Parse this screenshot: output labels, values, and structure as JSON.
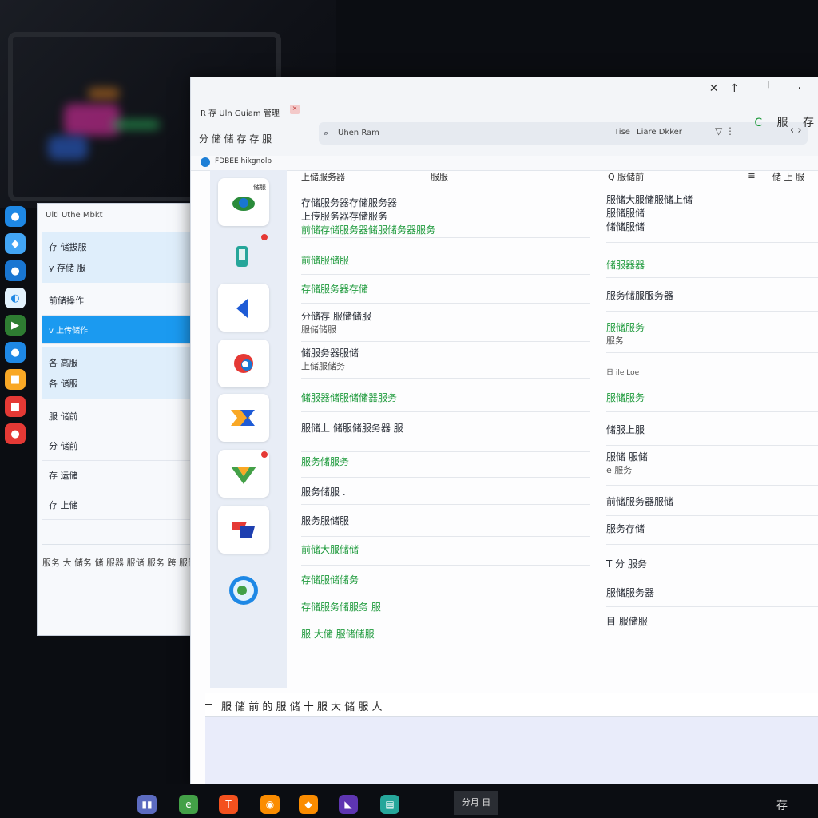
{
  "back_window": {
    "title": "Ulti Uthe Mbkt",
    "group1": [
      "存 储拔服",
      "y 存储 服"
    ],
    "item1": "前储操作",
    "active_item": "v 上传储作",
    "group2": [
      "各 高服",
      "各 储服"
    ],
    "items": [
      "服 储前",
      "分 储前",
      "存 运储",
      "存 上储"
    ],
    "footer": "服务 大 储务 储 服器 服储 服务 跨 服储"
  },
  "main_window": {
    "title": "R 存 Uln Guiam 管理",
    "toolbar_text": "分  储 储 存 存 服",
    "address": {
      "text": "Uhen Ram",
      "tag": "Tise",
      "user": "Liare Dkker",
      "nav": "‹ ›"
    },
    "right_tools": [
      "C",
      "服",
      "存"
    ],
    "subbar_text": "FDBEE hikgnolb"
  },
  "rail": {
    "tile1_badge": "储服"
  },
  "list": {
    "header_left": "上储服务器",
    "header_right": "服服",
    "rows": [
      {
        "line1": "存储服务器存储服务器",
        "line2": "上传服务器存储服务",
        "line3": "前储存储服务器储服储务器服务",
        "green": true
      },
      {
        "line1": "前储服储服",
        "green": true
      },
      {
        "line1": "存储服务器存储",
        "green": true
      },
      {
        "line1": "分储存 服储储服",
        "line2": "服储储服"
      },
      {
        "line1": "储服务器服储",
        "line2": "上储服储务"
      },
      {
        "line1": "储服器储服储储器服务",
        "green": true
      },
      {
        "line1": "服储上 储服储服务器 服"
      },
      {
        "line1": "服务储服务",
        "green": true
      },
      {
        "line1": "服务储服 ."
      },
      {
        "line1": "服务服储服"
      },
      {
        "line1": "前储大服储储",
        "green": true
      },
      {
        "line1": "存储服储储务",
        "green": true
      },
      {
        "line1": "存储服务储服务 服",
        "green": true
      },
      {
        "line1": "服 大储 服储储服",
        "green": true
      }
    ]
  },
  "right_panel": {
    "search": "Q 服储前",
    "user_label": "储 上 服",
    "rows": [
      {
        "line1": "服储大服储服储上储",
        "line2": "服储服储",
        "line3": "储储服储"
      },
      {
        "line1": "储服器器",
        "green": true
      },
      {
        "line1": "服务储服服务器"
      },
      {
        "line1": "服储服务",
        "line2": "服务",
        "green": true
      },
      {
        "line1": "日 ile Loe"
      },
      {
        "line1": "服储服务",
        "green": true
      },
      {
        "line1": "储服上服"
      },
      {
        "line1": "服储 服储",
        "line2": "e 服务"
      },
      {
        "line1": "前储服务器服储"
      },
      {
        "line1": "服务存储"
      },
      {
        "line1": "T 分 服务"
      },
      {
        "line1": "服储服务器"
      },
      {
        "line1": "目 服储服"
      }
    ]
  },
  "composer": {
    "text": "服 储 前 的 服 储 十 服 大 储 服 人"
  },
  "taskbar": {
    "clock": "分月 日",
    "ime": "存"
  },
  "colors": {
    "accent_blue": "#1b9af0",
    "green_text": "#1e9a3c",
    "dock_bg": "#0b0d12"
  }
}
